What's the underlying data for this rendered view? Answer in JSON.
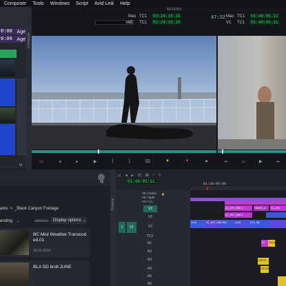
{
  "menu": [
    "Composer",
    "Tools",
    "Windows",
    "Script",
    "Avid Link",
    "Help"
  ],
  "left_panel": {
    "timecode_rows": [
      {
        "value": "0:00",
        "tag": "Age"
      },
      {
        "value": "0:00",
        "tag": "Age"
      }
    ],
    "toolbar_icon": "gear-icon"
  },
  "composer": {
    "side_label": "Composer",
    "window_title": "MXZERO",
    "src_seq_label": "W:2",
    "top_rows": [
      {
        "name": "Mas",
        "tc": "TC1",
        "value": "03:24:10.15"
      },
      {
        "name": "V1",
        "tc": "TC1",
        "value": "03:24:10.15"
      }
    ],
    "center_value": "47:22",
    "right_rows": [
      {
        "name": "Mas",
        "tc": "TC1",
        "value": "01:40:05.11"
      },
      {
        "name": "V1",
        "tc": "TC1",
        "value": "01:40:05.11"
      }
    ]
  },
  "bin": {
    "breadcrumb_prefix": "arks",
    "breadcrumb_sep": ">",
    "breadcrumb_current": "_Black Canyon Footage",
    "sort_label": "ending",
    "attributes_label": "attributes",
    "display_options": "Display options",
    "items": [
      {
        "title_line1": "BC Mist Weather.Transcod",
        "title_line2": "ed.01",
        "date": "18.10.2019"
      },
      {
        "title_line1": "BLA SD broll JUNE",
        "title_line2": "",
        "date": ""
      }
    ]
  },
  "timeline": {
    "side_label": "Timeline",
    "timecode": "01:40:05:11",
    "ruler_left": "01:30:05:09",
    "ruler_right": "01:30:05:09",
    "tracks": [
      {
        "label": "V6 / Notes"
      },
      {
        "label": "V5 / Split"
      },
      {
        "label": "V4 / CC"
      },
      {
        "label": "V3"
      },
      {
        "label": "V2"
      },
      {
        "label": "V1"
      },
      {
        "label": "TC1"
      },
      {
        "label": "A1"
      },
      {
        "label": "A2"
      },
      {
        "label": "A3"
      },
      {
        "label": "A4"
      },
      {
        "label": "A5"
      },
      {
        "label": "A6"
      }
    ],
    "patch_labels": {
      "v1_left": "1",
      "v1_right": "V1"
    },
    "clips": {
      "c1": "01_047_052.1",
      "c2": "HAND_cl",
      "c3": "01_024",
      "c4": "01_047_053.1",
      "c5": "cl.01",
      "c6": "01_047_048.1",
      "c7": "Blu",
      "c8": "cl.01",
      "c9": "K7L_BL",
      "c10": "01",
      "c11": "GuLas",
      "c12": "DROP",
      "c13": "DROP"
    }
  },
  "colors": {
    "accent_green": "#35d46b",
    "clip_purple": "#8a4fd6",
    "clip_magenta": "#c23ad0",
    "clip_blue": "#3a58d8",
    "track_green": "#1f6b5a",
    "audio_yellow": "#e6c21f"
  }
}
